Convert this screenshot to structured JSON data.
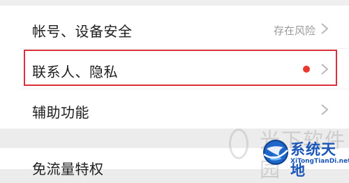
{
  "settings": {
    "rows": [
      {
        "label": "帐号、设备安全",
        "status": "存在风险"
      },
      {
        "label": "联系人、隐私",
        "status": ""
      },
      {
        "label": "辅助功能",
        "status": ""
      },
      {
        "label": "免流量特权",
        "status": ""
      }
    ]
  },
  "highlight": {
    "color": "#d9303a"
  },
  "notification": {
    "color": "#e8392d"
  },
  "icons": {
    "chevron": "chevron-right-icon"
  },
  "watermark": {
    "cn_text": "光下软件园",
    "badge_text": "系统天地",
    "badge_url": "XiTongTianDi.net"
  }
}
